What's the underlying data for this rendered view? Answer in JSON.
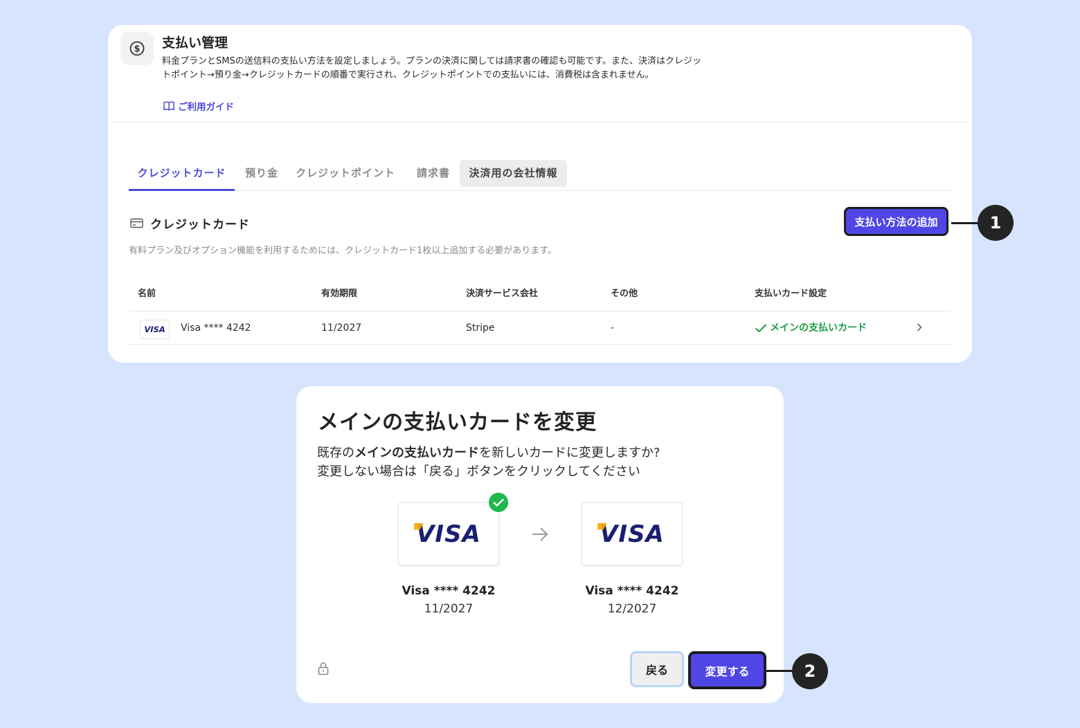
{
  "header": {
    "title": "支払い管理",
    "description": "料金プランとSMSの送信料の支払い方法を設定しましょう。プランの決済に関しては請求書の確認も可能です。また、決済はクレジットポイント→預り金→クレジットカードの順番で実行され、クレジットポイントでの支払いには、消費税は含まれません。",
    "guide_link": "ご利用ガイド",
    "icon": "dollar-circle-icon"
  },
  "tabs": [
    {
      "label": "クレジットカード"
    },
    {
      "label": "預り金"
    },
    {
      "label": "クレジットポイント"
    },
    {
      "label": "請求書"
    },
    {
      "label": "決済用の会社情報"
    }
  ],
  "section": {
    "title": "クレジットカード",
    "description": "有料プラン及びオプション機能を利用するためには、クレジットカード1枚以上追加する必要があります。",
    "add_button": "支払い方法の追加"
  },
  "table": {
    "columns": [
      "名前",
      "有効期限",
      "決済サービス会社",
      "その他",
      "支払いカード設定"
    ],
    "rows": [
      {
        "brand": "VISA",
        "name": "Visa **** 4242",
        "expiry": "11/2027",
        "provider": "Stripe",
        "other": "-",
        "setting": "メインの支払いカード"
      }
    ]
  },
  "callouts": [
    "1",
    "2"
  ],
  "dialog": {
    "title": "メインの支払いカードを変更",
    "message_prefix": "既存の",
    "message_bold": "メインの支払いカード",
    "message_suffix": "を新しいカードに変更しますか?",
    "message_line2": "変更しない場合は「戻る」ボタンをクリックしてください",
    "current_card": {
      "brand": "VISA",
      "name": "Visa **** 4242",
      "expiry": "11/2027"
    },
    "new_card": {
      "brand": "VISA",
      "name": "Visa **** 4242",
      "expiry": "12/2027"
    },
    "back_button": "戻る",
    "change_button": "変更する"
  },
  "colors": {
    "background": "#d6e4fd",
    "accent": "#4f46e5",
    "success": "#1e9e45",
    "visa_blue": "#1a1f71"
  }
}
